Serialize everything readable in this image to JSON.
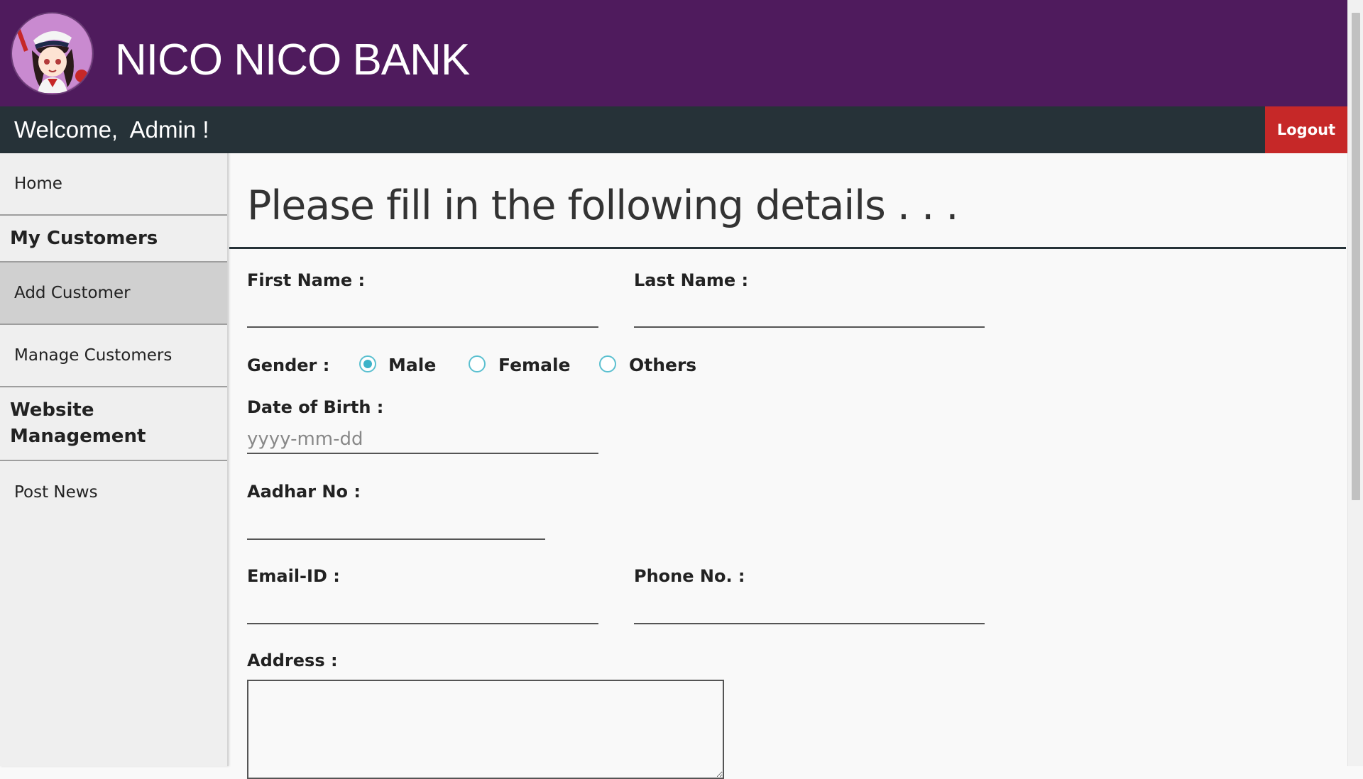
{
  "header": {
    "brand": "NICO NICO BANK"
  },
  "welcome_bar": {
    "welcome_text": "Welcome,  Admin !",
    "logout_label": "Logout"
  },
  "sidebar": {
    "home": "Home",
    "section_customers": "My Customers",
    "add_customer": "Add Customer",
    "manage_customers": "Manage Customers",
    "section_website": "Website Management",
    "post_news": "Post News"
  },
  "form": {
    "title": "Please fill in the following details . . .",
    "first_name_label": "First Name :",
    "last_name_label": "Last Name :",
    "gender_label": "Gender :",
    "gender_options": [
      "Male",
      "Female",
      "Others"
    ],
    "gender_selected": "Male",
    "dob_label": "Date of Birth :",
    "dob_placeholder": "yyyy-mm-dd",
    "aadhar_label": "Aadhar No :",
    "email_label": "Email-ID :",
    "phone_label": "Phone No. :",
    "address_label": "Address :"
  },
  "colors": {
    "header_bg": "#4f1b5d",
    "welcome_bar_bg": "#263238",
    "logout_bg": "#c62828",
    "active_nav_bg": "#d0d0d0",
    "radio_accent": "#3db3c9"
  }
}
